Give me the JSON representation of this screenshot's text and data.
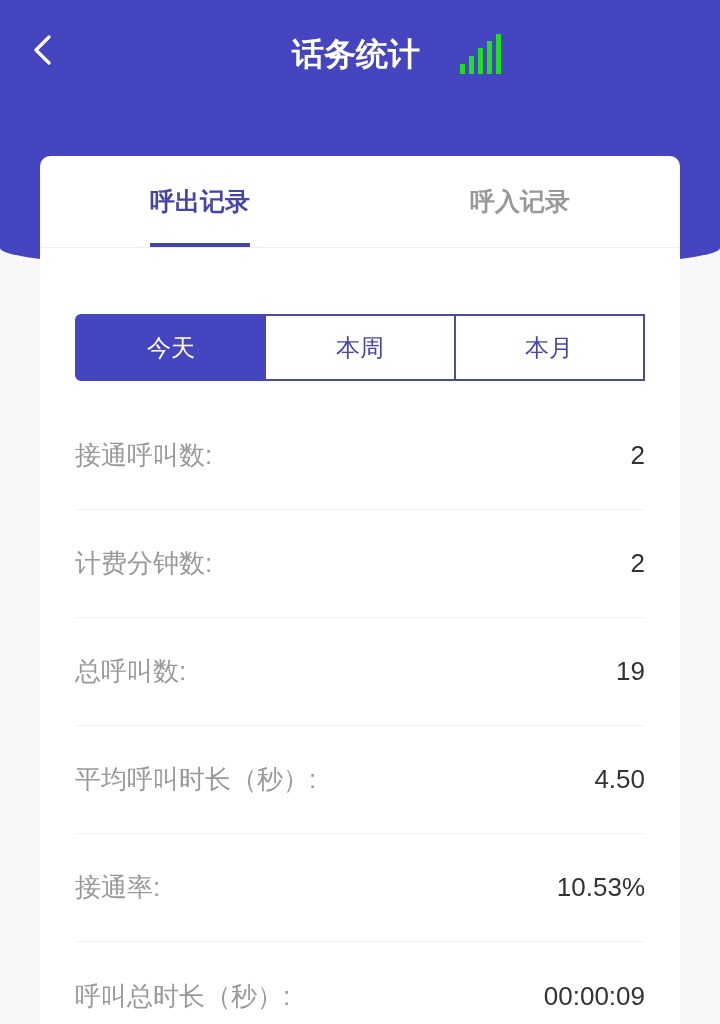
{
  "header": {
    "title": "话务统计"
  },
  "tabs": [
    {
      "label": "呼出记录",
      "selected": true
    },
    {
      "label": "呼入记录",
      "selected": false
    }
  ],
  "periods": [
    {
      "label": "今天",
      "selected": true
    },
    {
      "label": "本周",
      "selected": false
    },
    {
      "label": "本月",
      "selected": false
    }
  ],
  "stats": [
    {
      "label": "接通呼叫数:",
      "value": "2"
    },
    {
      "label": "计费分钟数:",
      "value": "2"
    },
    {
      "label": "总呼叫数:",
      "value": "19"
    },
    {
      "label": "平均呼叫时长（秒）:",
      "value": "4.50"
    },
    {
      "label": "接通率:",
      "value": "10.53%"
    },
    {
      "label": "呼叫总时长（秒）:",
      "value": "00:00:09"
    }
  ]
}
